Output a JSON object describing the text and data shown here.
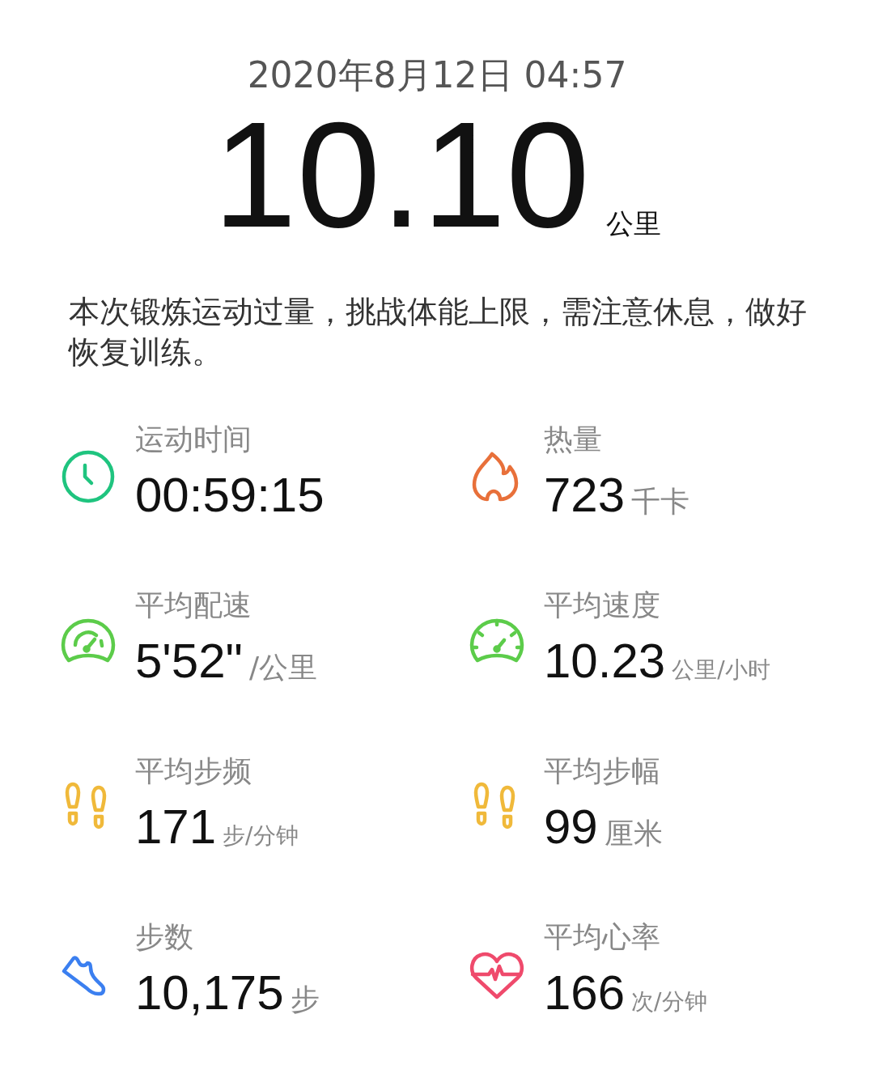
{
  "date": "2020年8月12日 04:57",
  "distance": {
    "value": "10.10",
    "unit": "公里"
  },
  "message": "本次锻炼运动过量，挑战体能上限，需注意休息，做好恢复训练。",
  "stats": [
    {
      "kind": "clock",
      "color": "#1fc47f",
      "label": "运动时间",
      "value": "00:59:15"
    },
    {
      "kind": "flame",
      "color": "#e8703a",
      "label": "热量",
      "value": "723",
      "unit": "千卡"
    },
    {
      "kind": "gauge",
      "color": "#5ccc4a",
      "label": "平均配速",
      "value": "5'52\"",
      "unit": "/公里"
    },
    {
      "kind": "speedometer",
      "color": "#5ccc4a",
      "label": "平均速度",
      "value": "10.23",
      "unit": "公里/小时"
    },
    {
      "kind": "footprints",
      "color": "#f0b93a",
      "label": "平均步频",
      "value": "171",
      "unit": "步/分钟"
    },
    {
      "kind": "footprints",
      "color": "#f0b93a",
      "label": "平均步幅",
      "value": "99",
      "unit": "厘米"
    },
    {
      "kind": "shoe",
      "color": "#3b7ff0",
      "label": "步数",
      "value": "10,175",
      "unit": "步"
    },
    {
      "kind": "heart",
      "color": "#ef4a6c",
      "label": "平均心率",
      "value": "166",
      "unit": "次/分钟"
    }
  ]
}
